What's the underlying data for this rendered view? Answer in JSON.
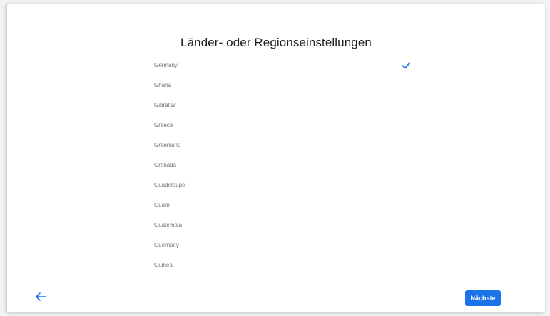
{
  "page": {
    "title": "Länder- oder Regionseinstellungen"
  },
  "regions": {
    "items": [
      {
        "label": "Germany",
        "selected": true
      },
      {
        "label": "Ghana",
        "selected": false
      },
      {
        "label": "Gibraltar",
        "selected": false
      },
      {
        "label": "Greece",
        "selected": false
      },
      {
        "label": "Greenland",
        "selected": false
      },
      {
        "label": "Grenada",
        "selected": false
      },
      {
        "label": "Guadeloupe",
        "selected": false
      },
      {
        "label": "Guam",
        "selected": false
      },
      {
        "label": "Guatemala",
        "selected": false
      },
      {
        "label": "Guernsey",
        "selected": false
      },
      {
        "label": "Guinea",
        "selected": false
      }
    ],
    "selected_icon": "checkmark-icon"
  },
  "footer": {
    "back_icon": "arrow-left-icon",
    "next_label": "Nächste"
  },
  "colors": {
    "accent": "#1a73e8",
    "background": "#ffffff",
    "outer_background": "#f2f3f5",
    "title_text": "#202124",
    "item_text": "#6d7278"
  }
}
